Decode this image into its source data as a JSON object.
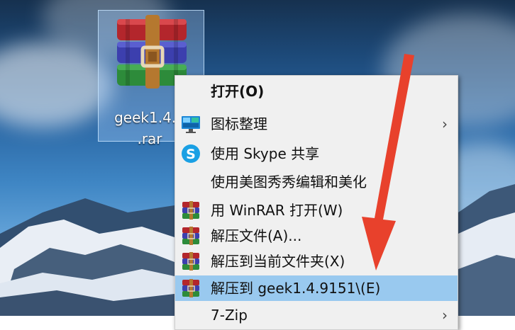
{
  "desktop": {
    "file_icon_name": "rar-archive-icon",
    "file_name_line1": "geek1.4.9",
    "file_name_line2": ".rar"
  },
  "context_menu": {
    "items": [
      {
        "label": "打开(O)",
        "icon": "none",
        "bold": true
      },
      {
        "label": "图标整理",
        "icon": "monitor-icon",
        "submenu": true
      },
      {
        "label": "使用 Skype 共享",
        "icon": "skype-icon"
      },
      {
        "label": "使用美图秀秀编辑和美化",
        "icon": "none"
      },
      {
        "label": "用 WinRAR 打开(W)",
        "icon": "winrar-icon"
      },
      {
        "label": "解压文件(A)...",
        "icon": "winrar-icon"
      },
      {
        "label": "解压到当前文件夹(X)",
        "icon": "winrar-icon"
      },
      {
        "label": "解压到 geek1.4.9151\\(E)",
        "icon": "winrar-icon",
        "highlighted": true
      },
      {
        "label": "7-Zip",
        "icon": "none",
        "submenu": true
      }
    ],
    "submenu_arrow": "›",
    "highlight_color": "#99c9ef"
  },
  "annotation": {
    "arrow_color": "#e8412c"
  }
}
